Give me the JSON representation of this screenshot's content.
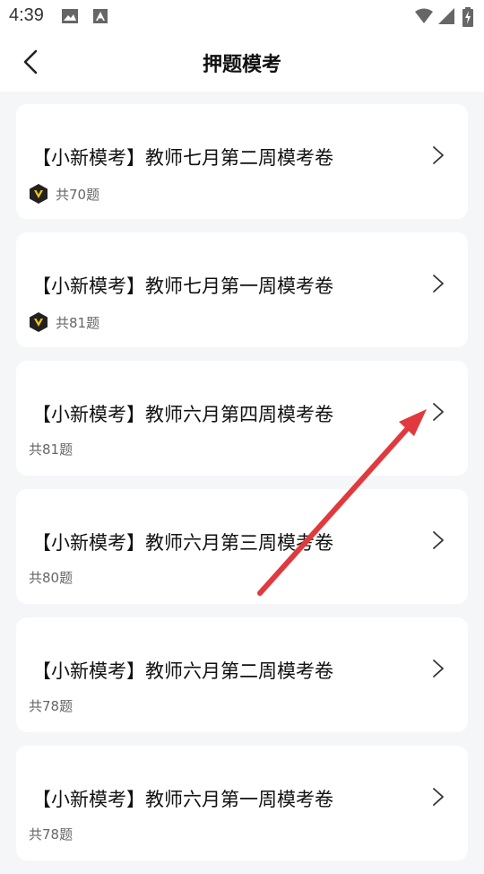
{
  "status_bar": {
    "time": "4:39"
  },
  "header": {
    "title": "押题模考"
  },
  "cards": [
    {
      "title": "【小新模考】教师七月第二周模考卷",
      "count": "共70题",
      "vip": true
    },
    {
      "title": "【小新模考】教师七月第一周模考卷",
      "count": "共81题",
      "vip": true
    },
    {
      "title": "【小新模考】教师六月第四周模考卷",
      "count": "共81题",
      "vip": false
    },
    {
      "title": "【小新模考】教师六月第三周模考卷",
      "count": "共80题",
      "vip": false
    },
    {
      "title": "【小新模考】教师六月第二周模考卷",
      "count": "共78题",
      "vip": false
    },
    {
      "title": "【小新模考】教师六月第一周模考卷",
      "count": "共78题",
      "vip": false
    }
  ],
  "colors": {
    "annotation_arrow": "#e03a3e",
    "vip_badge_bg": "#222222",
    "vip_badge_fg": "#f5c518"
  }
}
